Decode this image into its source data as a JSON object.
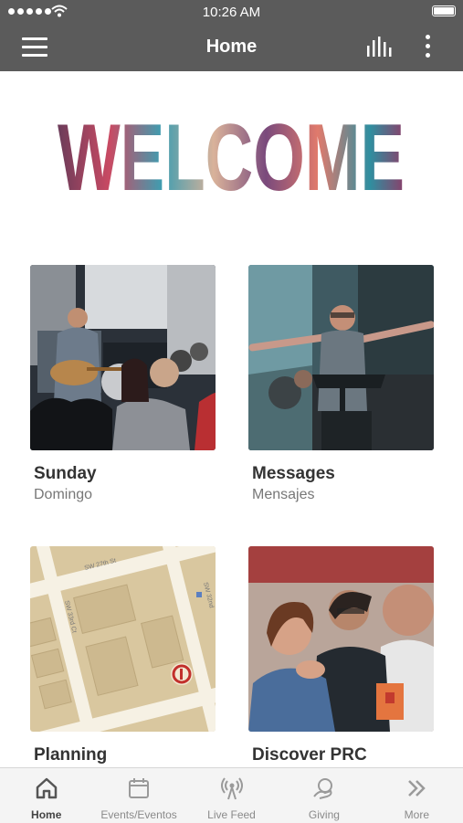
{
  "status_bar": {
    "time": "10:26 AM"
  },
  "header": {
    "title": "Home"
  },
  "welcome": {
    "text": "WELCOME"
  },
  "tiles": [
    {
      "title": "Sunday",
      "subtitle": "Domingo"
    },
    {
      "title": "Messages",
      "subtitle": "Mensajes"
    },
    {
      "title": "Planning",
      "subtitle": ""
    },
    {
      "title": "Discover PRC",
      "subtitle": ""
    }
  ],
  "map": {
    "street_top": "SW 27th St",
    "street_left": "SW 33rd Ct",
    "street_right": "SW 32nd"
  },
  "tabs": [
    {
      "label": "Home",
      "icon": "home-icon",
      "active": true
    },
    {
      "label": "Events/Eventos",
      "icon": "calendar-icon",
      "active": false
    },
    {
      "label": "Live Feed",
      "icon": "broadcast-icon",
      "active": false
    },
    {
      "label": "Giving",
      "icon": "giving-icon",
      "active": false
    },
    {
      "label": "More",
      "icon": "chevrons-right-icon",
      "active": false
    }
  ],
  "colors": {
    "header_bg": "#5b5b5b",
    "tab_bg": "#f4f4f4",
    "title_text": "#333333",
    "subtitle_text": "#777777"
  }
}
